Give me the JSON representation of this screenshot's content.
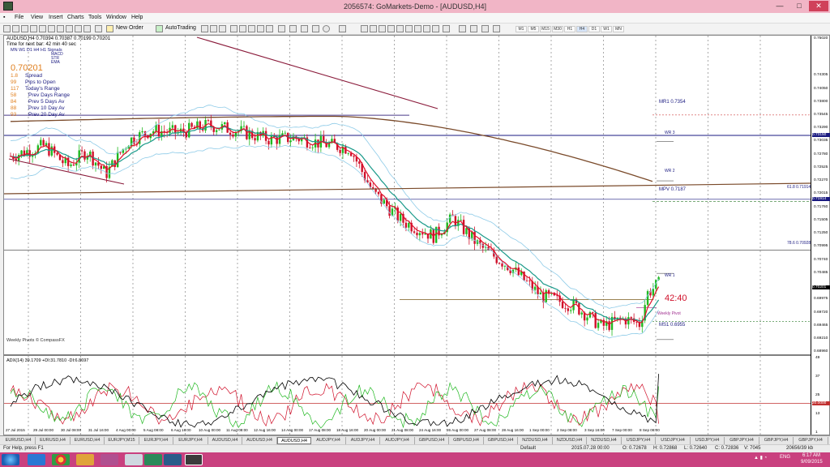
{
  "window": {
    "title": "2056574: GoMarkets-Demo - [AUDUSD,H4]",
    "minimize": "—",
    "maximize": "□",
    "close": "✕"
  },
  "menu": [
    "File",
    "View",
    "Insert",
    "Charts",
    "Tools",
    "Window",
    "Help"
  ],
  "toolbar": {
    "new_order": "New Order",
    "autotrading": "AutoTrading",
    "timeframes": [
      "M1",
      "M5",
      "M15",
      "M30",
      "H1",
      "H4",
      "D1",
      "W1",
      "MN"
    ]
  },
  "chart": {
    "header": "AUDUSD,H4  0.70394 0.70387 0.70199 0.70201",
    "countdown_line": "Time for next bar: 42 min 40 sec",
    "signals_header": "MN  W1  D1  H4  H1  Signals",
    "signals_legend": [
      "MACD",
      "STR",
      "EMA"
    ],
    "price_big": "0.70201",
    "stats": [
      {
        "num": "1.8",
        "label": "Spread"
      },
      {
        "num": "99",
        "label": "Pips to Open"
      },
      {
        "num": "117",
        "label": "Today's Range"
      },
      {
        "num": "58",
        "label": "Prev Days Range"
      },
      {
        "num": "84",
        "label": "Prev 5 Days Av"
      },
      {
        "num": "88",
        "label": "Prev 10 Day Av"
      },
      {
        "num": "93",
        "label": "Prev 20 Day Av"
      }
    ],
    "pivot_credit": "Weekly Pivots © CompassFX",
    "countdown_big": "42:40",
    "pivot_labels": {
      "mr1": "MR1  0.7354",
      "wr3": "WR 3",
      "wr2": "WR 2",
      "mpv": "MPV  0.7187",
      "wr1": "WR 1",
      "weekly_pivot": "Weekly Pivot",
      "ms1": "MS1  0.6955",
      "fib618": "61.8  0.71914",
      "fib786": "78.6  0.70928"
    },
    "price_ticks": [
      "0.75020",
      "0.74305",
      "0.74050",
      "0.73800",
      "0.73545",
      "0.73290",
      "0.73035",
      "0.72780",
      "0.72525",
      "0.72270",
      "0.72015",
      "0.71760",
      "0.71505",
      "0.71250",
      "0.70995",
      "0.70740",
      "0.70485",
      "0.70201",
      "0.69975",
      "0.69720",
      "0.69465",
      "0.69210",
      "0.68960"
    ],
    "highlight_ticks": {
      "0.73150": "0.73150",
      "0.71914": "0.71914",
      "current": "0.70201",
      "adx_level": "20.0000"
    },
    "adx_header": "ADX(14) 39.1709 +DI:31.7810 -DI:6.8697",
    "adx_ticks": [
      "49",
      "37",
      "25",
      "13",
      "1"
    ],
    "time_labels": [
      "27 Jul 2015",
      "29 Jul 00:00",
      "30 Jul 08:00",
      "31 Jul 16:00",
      "4 Aug 00:00",
      "5 Aug 08:00",
      "6 Aug 16:00",
      "10 Aug 00:00",
      "11 Aug 08:00",
      "12 Aug 16:00",
      "14 Aug 00:00",
      "17 Aug 08:00",
      "18 Aug 16:00",
      "20 Aug 00:00",
      "21 Aug 08:00",
      "24 Aug 16:00",
      "26 Aug 00:00",
      "27 Aug 08:00",
      "28 Aug 16:00",
      "1 Sep 00:00",
      "2 Sep 08:00",
      "3 Sep 16:00",
      "7 Sep 00:00",
      "8 Sep 08:00"
    ]
  },
  "tabs": [
    "EURUSD,H4",
    "EURUSD,H4",
    "EURUSD,H4",
    "EURJPY,M15",
    "EURJPY,H4",
    "EURJPY,H4",
    "AUDUSD,H4",
    "AUDUSD,H4",
    "AUDUSD,H4",
    "AUDJPY,H4",
    "AUDJPY,H4",
    "AUDJPY,H4",
    "GBPUSD,H4",
    "GBPUSD,H4",
    "GBPUSD,H4",
    "NZDUSD,H4",
    "NZDUSD,H4",
    "NZDUSD,H4",
    "USDJPY,H4",
    "USDJPY,H4",
    "USDJPY,H4",
    "GBPJPY,H4",
    "GBPJPY,H4",
    "GBPJPY,H4"
  ],
  "active_tab_index": 8,
  "status": {
    "help": "For Help, press F1",
    "profile": "Default",
    "time": "2015.07.28 00:00",
    "o": "O: 0.72678",
    "h": "H: 0.72868",
    "l": "L: 0.72640",
    "c": "C: 0.72836",
    "v": "V: 7045",
    "traffic": "20656/39 kb"
  },
  "taskbar": {
    "lang": "ENG",
    "clock_time": "6:17 AM",
    "clock_date": "9/09/2015"
  },
  "colors": {
    "titlebar": "#f1b5c6",
    "taskbar": "#c9417f",
    "bull_candle": "#1fb81f",
    "bear_candle": "#d0102a",
    "ema_fast": "#e0102a",
    "ema_slow": "#1a9a8a",
    "bollinger": "#8ecbe8",
    "long_ma": "#7a4a2a",
    "pivot_line": "#1a1a80",
    "adx_line": "#000000",
    "plus_di": "#1fb81f",
    "minus_di": "#d0102a"
  }
}
